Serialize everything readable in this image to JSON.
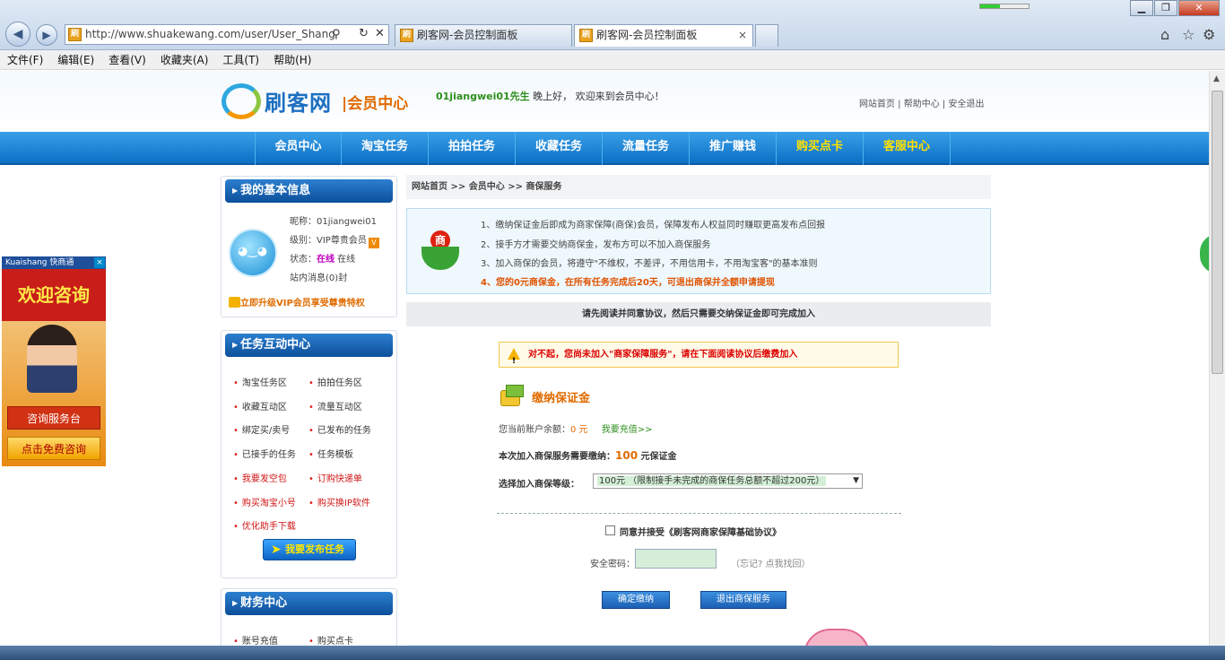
{
  "browser": {
    "url": "http://www.shuakewang.com/user/User_Shang",
    "tabs": [
      "刷客网-会员控制面板",
      "刷客网-会员控制面板"
    ],
    "tab_close": "×",
    "menu": [
      "文件(F)",
      "编辑(E)",
      "查看(V)",
      "收藏夹(A)",
      "工具(T)",
      "帮助(H)"
    ],
    "favicon_char": "刷"
  },
  "header": {
    "logo_name": "刷客网",
    "logo_sub": "|会员中心",
    "username": "01jiangwei01先生",
    "greeting": " 晚上好， 欢迎来到会员中心！",
    "toplinks": "网站首页 | 帮助中心 | 安全退出"
  },
  "nav": [
    "会员中心",
    "淘宝任务",
    "拍拍任务",
    "收藏任务",
    "流量任务",
    "推广赚钱",
    "购买点卡",
    "客服中心"
  ],
  "sidebar": {
    "basic_title": "我的基本信息",
    "nickname": "昵称：01jiangwei01",
    "level_label": "级别：",
    "level_value": "VIP尊贵会员",
    "status_label": "状态：",
    "status_value": "在线",
    "status_extra": " 在线",
    "messages": "站内消息(0)封",
    "upgrade": "立即升级VIP会员享受尊贵特权",
    "task_title": "任务互动中心",
    "tasks": [
      "淘宝任务区",
      "拍拍任务区",
      "收藏互动区",
      "流量互动区",
      "绑定买/卖号",
      "已发布的任务",
      "已接手的任务",
      "任务模板",
      "我要发空包",
      "订购快递单",
      "购买淘宝小号",
      "购买换IP软件",
      "优化助手下载"
    ],
    "publish_btn": "我要发布任务",
    "finance_title": "财务中心",
    "finance": [
      "账号充值",
      "购买点卡"
    ]
  },
  "main": {
    "breadcrumb": "网站首页 >> 会员中心 >> 商保服务",
    "notice_icon_char": "商",
    "notice_lines": [
      "1、缴纳保证金后即成为商家保障(商保)会员，保障发布人权益同时赚取更高发布点回报",
      "2、接手方才需要交纳商保金，发布方可以不加入商保服务",
      "3、加入商保的会员，将遵守\"不维权，不差评，不用信用卡，不用淘宝客\"的基本准则",
      "4、您的0元商保金，在所有任务完成后20天，可退出商保并全额申请提现"
    ],
    "agree_bar": "请先阅读并同意协议，然后只需要交纳保证金即可完成加入",
    "warning": "对不起，您尚未加入\"商家保障服务\"，请在下面阅读协议后缴费加入",
    "pay_title": "缴纳保证金",
    "balance_label": "您当前账户余额：",
    "balance_value": "0 元",
    "recharge": "我要充值>>",
    "need_label": "本次加入商保服务需要缴纳：",
    "need_value": "100",
    "need_unit": " 元保证金",
    "level_label": "选择加入商保等级：",
    "level_option": "100元 （限制接手未完成的商保任务总额不超过200元）",
    "agree_label": "同意并接受《刷客网商家保障基础协议》",
    "password_label": "安全密码：",
    "password_hint": "（忘记? 点我找回）",
    "confirm_btn": "确定缴纳",
    "exit_btn": "退出商保服务"
  },
  "ad": {
    "brand": "Kuaishang 快商通",
    "close": "×",
    "headline": "欢迎咨询",
    "btn1": "咨询服务台",
    "btn2": "点击免费咨询"
  },
  "colors": {
    "nav_blue": "#0c6fc4",
    "highlight_yellow": "#ffe100",
    "warning_red": "#d00000",
    "orange": "#e06b00",
    "online_magenta": "#c000c0"
  }
}
